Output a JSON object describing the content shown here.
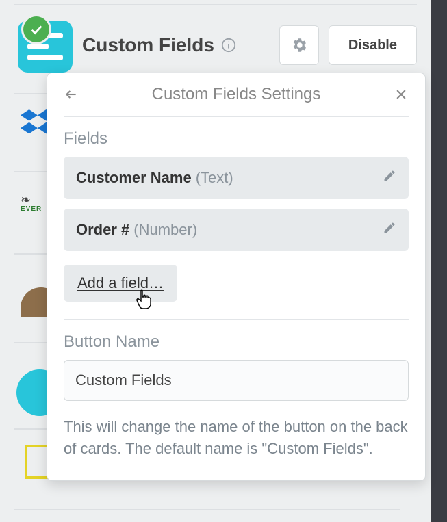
{
  "powerup": {
    "title": "Custom Fields",
    "disable_label": "Disable"
  },
  "popover": {
    "title": "Custom Fields Settings",
    "fields_section_label": "Fields",
    "fields": [
      {
        "name": "Customer Name",
        "type": "(Text)"
      },
      {
        "name": "Order #",
        "type": "(Number)"
      }
    ],
    "add_field_label": "Add a field…",
    "button_name_label": "Button Name",
    "button_name_value": "Custom Fields",
    "helper_text": "This will change the name of the button on the back of cards. The default name is \"Custom Fields\"."
  }
}
